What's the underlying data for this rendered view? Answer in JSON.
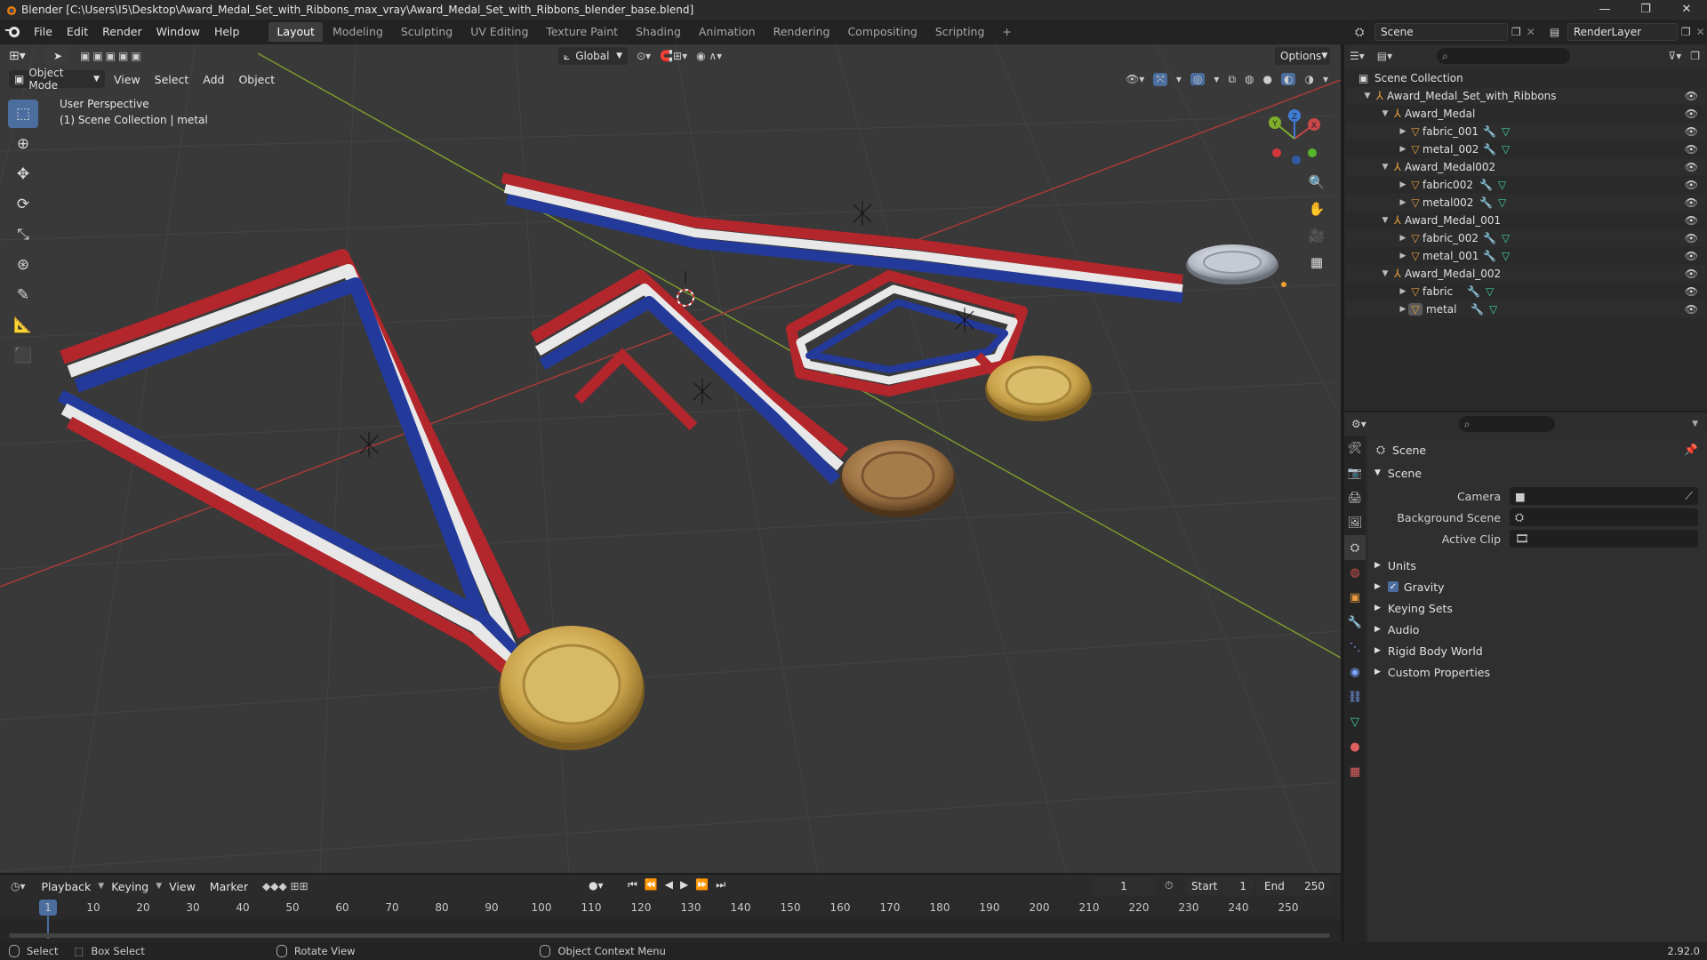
{
  "window": {
    "title": "Blender [C:\\Users\\I5\\Desktop\\Award_Medal_Set_with_Ribbons_max_vray\\Award_Medal_Set_with_Ribbons_blender_base.blend]",
    "minimize": "—",
    "maximize": "❐",
    "close": "✕"
  },
  "menu": [
    "File",
    "Edit",
    "Render",
    "Window",
    "Help"
  ],
  "workspaces": [
    "Layout",
    "Modeling",
    "Sculpting",
    "UV Editing",
    "Texture Paint",
    "Shading",
    "Animation",
    "Rendering",
    "Compositing",
    "Scripting"
  ],
  "add_workspace": "+",
  "scene_field": "Scene",
  "renderlayer_field": "RenderLayer",
  "viewport": {
    "mode": "Object Mode",
    "menus": [
      "View",
      "Select",
      "Add",
      "Object"
    ],
    "orientation": "Global",
    "options": "Options",
    "perspective": "User Perspective",
    "collection_info": "(1) Scene Collection | metal",
    "gizmo": {
      "x": "X",
      "y": "Y",
      "z": "Z"
    }
  },
  "tools": [
    "select-box",
    "cursor",
    "move",
    "rotate",
    "scale",
    "transform",
    "annotate",
    "measure",
    "add-cube"
  ],
  "outliner": {
    "root": "Scene Collection",
    "items": [
      {
        "label": "Award_Medal_Set_with_Ribbons",
        "level": 1,
        "type": "empty"
      },
      {
        "label": "Award_Medal",
        "level": 2,
        "type": "empty"
      },
      {
        "label": "fabric_001",
        "level": 3,
        "type": "mesh"
      },
      {
        "label": "metal_002",
        "level": 3,
        "type": "mesh"
      },
      {
        "label": "Award_Medal002",
        "level": 2,
        "type": "empty"
      },
      {
        "label": "fabric002",
        "level": 3,
        "type": "mesh"
      },
      {
        "label": "metal002",
        "level": 3,
        "type": "mesh"
      },
      {
        "label": "Award_Medal_001",
        "level": 2,
        "type": "empty"
      },
      {
        "label": "fabric_002",
        "level": 3,
        "type": "mesh"
      },
      {
        "label": "metal_001",
        "level": 3,
        "type": "mesh"
      },
      {
        "label": "Award_Medal_002",
        "level": 2,
        "type": "empty"
      },
      {
        "label": "fabric",
        "level": 3,
        "type": "mesh"
      },
      {
        "label": "metal",
        "level": 3,
        "type": "mesh"
      }
    ]
  },
  "properties": {
    "context": "Scene",
    "section": "Scene",
    "fields": [
      {
        "label": "Camera",
        "value": ""
      },
      {
        "label": "Background Scene",
        "value": ""
      },
      {
        "label": "Active Clip",
        "value": ""
      }
    ],
    "panels": [
      "Units",
      "Gravity",
      "Keying Sets",
      "Audio",
      "Rigid Body World",
      "Custom Properties"
    ],
    "gravity_checked": true
  },
  "timeline": {
    "menus": [
      "Playback",
      "Keying",
      "View",
      "Marker"
    ],
    "current_frame": "1",
    "start_label": "Start",
    "start": "1",
    "end_label": "End",
    "end": "250",
    "ticks": [
      "1",
      "10",
      "20",
      "30",
      "40",
      "50",
      "60",
      "70",
      "80",
      "90",
      "100",
      "110",
      "120",
      "130",
      "140",
      "150",
      "160",
      "170",
      "180",
      "190",
      "200",
      "210",
      "220",
      "230",
      "240",
      "250"
    ]
  },
  "status": {
    "select": "Select",
    "box_select": "Box Select",
    "rotate_view": "Rotate View",
    "context_menu": "Object Context Menu",
    "version": "2.92.0"
  },
  "colors": {
    "accent": "#4b6e9f",
    "ribbon_red": "#b3262b",
    "ribbon_blue": "#243a9a",
    "ribbon_white": "#e8e8e8",
    "gold": "#d4b35a",
    "bronze": "#a77d4d",
    "silver": "#c9ccd4"
  }
}
